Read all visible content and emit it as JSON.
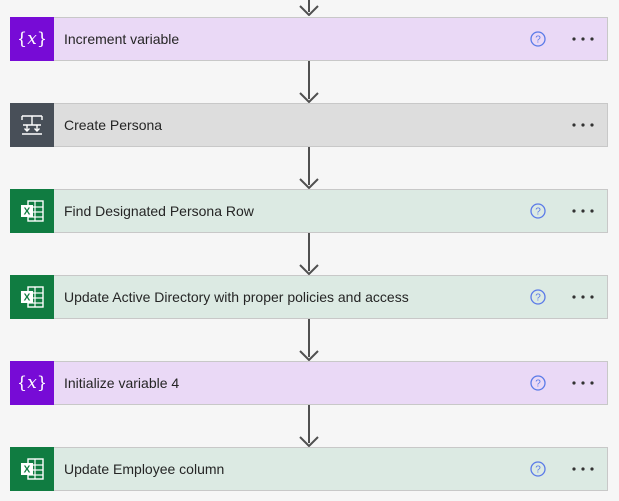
{
  "colors": {
    "variable_accent": "#770bd6",
    "variable_bg": "#ead9f6",
    "control_accent": "#484f58",
    "control_bg": "#dddddd",
    "excel_accent": "#107c41",
    "excel_bg": "#dceae3",
    "help_icon": "#5a7ae8"
  },
  "steps": [
    {
      "title": "Increment variable",
      "icon": "variable-icon",
      "has_help": true
    },
    {
      "title": "Create Persona",
      "icon": "apply-to-each-icon",
      "has_help": false
    },
    {
      "title": "Find Designated Persona Row",
      "icon": "excel-icon",
      "has_help": true
    },
    {
      "title": "Update Active Directory with proper policies and access",
      "icon": "excel-icon",
      "has_help": true
    },
    {
      "title": "Initialize variable 4",
      "icon": "variable-icon",
      "has_help": true
    },
    {
      "title": "Update Employee column",
      "icon": "excel-icon",
      "has_help": true
    }
  ]
}
